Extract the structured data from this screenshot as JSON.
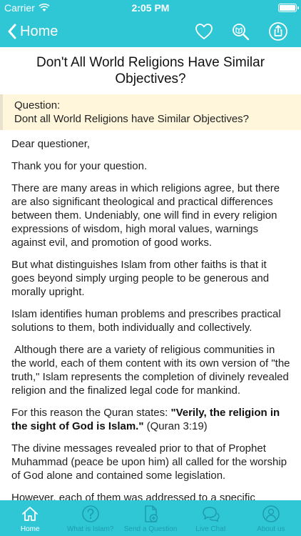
{
  "status_bar": {
    "carrier": "Carrier",
    "time": "2:05 PM"
  },
  "nav": {
    "back_label": "Home",
    "icons": [
      "heart-icon",
      "search-quran-icon",
      "share-icon"
    ]
  },
  "article": {
    "title": "Don't All World Religions Have Similar Objectives?",
    "question_label": "Question:",
    "question_text": "Dont all World Religions have Similar Objectives?",
    "paragraphs": {
      "p1": "Dear questioner,",
      "p2": "Thank you for your question.",
      "p3": "There are many areas in which religions agree, but there are also significant theological and practical differences between them. Undeniably, one will find in every religion expressions of wisdom, high moral values, warnings against evil, and promotion of good works.",
      "p4": "But what distinguishes Islam from other faiths is that it goes beyond simply urging people to be generous and morally upright.",
      "p5": "Islam identifies human problems and prescribes practical solutions to them, both individually and collectively.",
      "p6": " Although there are a variety of religious communities in the world, each of them content with its own version of \"the truth,\" Islam represents the completion of divinely revealed religion and the finalized legal code for mankind.",
      "p7_intro": "For this reason the Quran states: ",
      "p7_quote": "\"Verily, the religion in the sight of God is Islam.\"",
      "p7_ref": " (Quran 3:19)",
      "p8": "The divine messages revealed prior to that of Prophet Muhammad (peace be upon him) all called for the worship of God alone and contained some legislation.",
      "p9": "However, each of them was addressed to a specific"
    }
  },
  "tab_bar": {
    "tabs": [
      {
        "label": "Home",
        "icon": "home-icon"
      },
      {
        "label": "What is Islam?",
        "icon": "question-icon"
      },
      {
        "label": "Send a Question",
        "icon": "send-question-icon"
      },
      {
        "label": "Live Chat",
        "icon": "chat-icon"
      },
      {
        "label": "About us",
        "icon": "about-icon"
      }
    ],
    "active_index": 0
  },
  "colors": {
    "accent": "#2fc6d6",
    "question_bg": "#fff6dc",
    "tab_inactive": "#1a97a7"
  }
}
